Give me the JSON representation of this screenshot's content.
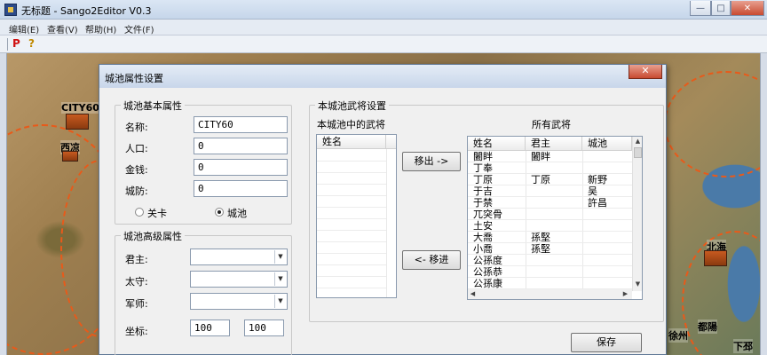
{
  "window": {
    "title": "无标题 - Sango2Editor V0.3",
    "min_glyph": "—",
    "max_glyph": "□",
    "close_glyph": "✕"
  },
  "menu": [
    {
      "label": "编辑(E)"
    },
    {
      "label": "查看(V)"
    },
    {
      "label": "帮助(H)"
    },
    {
      "label": "文件(F)"
    }
  ],
  "toolbar": {
    "p_label": "P",
    "help_label": "?"
  },
  "map": {
    "city60_label": "CITY60",
    "city60_name": "西凉",
    "beihai_name": "北海",
    "duyang_name": "都陽",
    "xuzhou_name": "徐州",
    "xia_name": "下邳"
  },
  "dialog": {
    "title": "城池属性设置",
    "close_glyph": "✕",
    "basic": {
      "group_title": "城池基本属性",
      "name_label": "名称:",
      "name_value": "CITY60",
      "population_label": "人口:",
      "population_value": "0",
      "money_label": "金钱:",
      "money_value": "0",
      "defense_label": "城防:",
      "defense_value": "0",
      "radio_pass": "关卡",
      "radio_city": "城池",
      "selected": "城池"
    },
    "advanced": {
      "group_title": "城池高级属性",
      "lord_label": "君主:",
      "lord_value": "",
      "governor_label": "太守:",
      "governor_value": "",
      "advisor_label": "军师:",
      "advisor_value": "",
      "coord_label": "坐标:",
      "coord_x": "100",
      "coord_y": "100"
    },
    "generals": {
      "group_title": "本城池武将设置",
      "city_list_title": "本城池中的武将",
      "city_list_header": "姓名",
      "all_list_title": "所有武将",
      "all_headers": [
        "姓名",
        "君主",
        "城池"
      ],
      "move_out_label": "移出 ->",
      "move_in_label": "<- 移进",
      "rows": [
        {
          "name": "闔眫",
          "lord": "闔眫",
          "city": ""
        },
        {
          "name": "丁奉",
          "lord": "",
          "city": ""
        },
        {
          "name": "丁原",
          "lord": "丁原",
          "city": "新野"
        },
        {
          "name": "于吉",
          "lord": "",
          "city": "吴"
        },
        {
          "name": "于禁",
          "lord": "",
          "city": "許昌"
        },
        {
          "name": "兀突骨",
          "lord": "",
          "city": ""
        },
        {
          "name": "土安",
          "lord": "",
          "city": ""
        },
        {
          "name": "大喬",
          "lord": "孫堅",
          "city": ""
        },
        {
          "name": "小喬",
          "lord": "孫堅",
          "city": ""
        },
        {
          "name": "公孫度",
          "lord": "",
          "city": ""
        },
        {
          "name": "公孫恭",
          "lord": "",
          "city": ""
        },
        {
          "name": "公孫康",
          "lord": "",
          "city": ""
        }
      ]
    },
    "save_label": "保存"
  }
}
